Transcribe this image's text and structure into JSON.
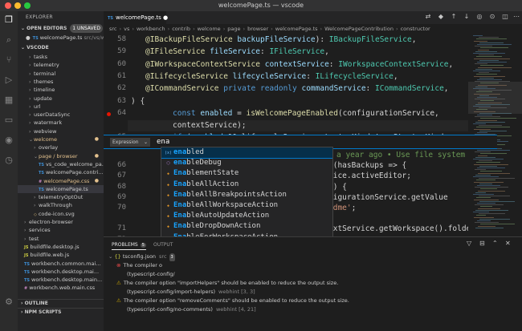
{
  "window": {
    "title": "welcomePage.ts — vscode"
  },
  "activity_bar": {
    "icons": [
      "files-icon",
      "search-icon",
      "source-control-icon",
      "run-debug-icon",
      "extensions-icon",
      "remote-explorer-icon",
      "github-icon",
      "timeline-icon",
      "settings-gear-icon"
    ]
  },
  "sidebar": {
    "header": "EXPLORER",
    "open_editors": {
      "label": "OPEN EDITORS",
      "badge": "1 UNSAVED"
    },
    "open_editor_item": {
      "name": "welcomePage.ts",
      "path": "src/vs/w..."
    },
    "vscode_section": "VSCODE",
    "tree": [
      {
        "label": "tasks",
        "type": "folder",
        "indent": 2
      },
      {
        "label": "telemetry",
        "type": "folder",
        "indent": 2
      },
      {
        "label": "terminal",
        "type": "folder",
        "indent": 2
      },
      {
        "label": "themes",
        "type": "folder",
        "indent": 2
      },
      {
        "label": "timeline",
        "type": "folder",
        "indent": 2
      },
      {
        "label": "update",
        "type": "folder",
        "indent": 2
      },
      {
        "label": "url",
        "type": "folder",
        "indent": 2
      },
      {
        "label": "userDataSync",
        "type": "folder",
        "indent": 2
      },
      {
        "label": "watermark",
        "type": "folder",
        "indent": 2
      },
      {
        "label": "webview",
        "type": "folder",
        "indent": 2
      },
      {
        "label": "welcome",
        "type": "folder-open",
        "indent": 2,
        "modified": true
      },
      {
        "label": "overlay",
        "type": "folder",
        "indent": 3
      },
      {
        "label": "page / browser",
        "type": "folder-open",
        "indent": 3,
        "modified": true
      },
      {
        "label": "vs_code_welcome_pa...",
        "type": "ts",
        "indent": 4
      },
      {
        "label": "welcomePage.contri...",
        "type": "ts",
        "indent": 4
      },
      {
        "label": "welcomePage.css",
        "type": "css",
        "indent": 4,
        "modified": true
      },
      {
        "label": "welcomePage.ts",
        "type": "ts",
        "indent": 4,
        "selected": true
      },
      {
        "label": "telemetryOptOut",
        "type": "folder",
        "indent": 3
      },
      {
        "label": "walkThrough",
        "type": "folder",
        "indent": 3
      },
      {
        "label": "code-icon.svg",
        "type": "svg",
        "indent": 3
      },
      {
        "label": "electron-browser",
        "type": "folder",
        "indent": 1
      },
      {
        "label": "services",
        "type": "folder",
        "indent": 1
      },
      {
        "label": "test",
        "type": "folder",
        "indent": 1
      },
      {
        "label": "buildfile.desktop.js",
        "type": "js",
        "indent": 1
      },
      {
        "label": "buildfile.web.js",
        "type": "js",
        "indent": 1
      },
      {
        "label": "workbench.common.mai...",
        "type": "ts",
        "indent": 1
      },
      {
        "label": "workbench.desktop.mai...",
        "type": "ts",
        "indent": 1
      },
      {
        "label": "workbench.desktop.main...",
        "type": "ts",
        "indent": 1
      },
      {
        "label": "workbench.web.main.css",
        "type": "css",
        "indent": 1
      }
    ],
    "outline": "OUTLINE",
    "npm_scripts": "NPM SCRIPTS"
  },
  "tabs": [
    {
      "label": "welcomePage.ts",
      "dirty": true
    }
  ],
  "breadcrumb": [
    "src",
    "vs",
    "workbench",
    "contrib",
    "welcome",
    "page",
    "browser",
    "welcomePage.ts",
    "WelcomePageContribution",
    "constructor"
  ],
  "editor": {
    "lines_top": [
      {
        "n": "58",
        "code": [
          [
            "dec",
            "@IBackupFileService "
          ],
          [
            "var",
            "backupFileService"
          ],
          [
            "",
            "): "
          ],
          [
            "ty",
            "IBackupFileService"
          ],
          [
            "",
            ","
          ]
        ]
      },
      {
        "n": "59",
        "code": [
          [
            "dec",
            "@IFileService "
          ],
          [
            "var",
            "fileService"
          ],
          [
            "",
            ": "
          ],
          [
            "ty",
            "IFileService"
          ],
          [
            "",
            ","
          ]
        ]
      },
      {
        "n": "60",
        "code": [
          [
            "dec",
            "@IWorkspaceContextService "
          ],
          [
            "var",
            "contextService"
          ],
          [
            "",
            ": "
          ],
          [
            "ty",
            "IWorkspaceContextService"
          ],
          [
            "",
            ","
          ]
        ]
      },
      {
        "n": "61",
        "code": [
          [
            "dec",
            "@ILifecycleService "
          ],
          [
            "var",
            "lifecycleService"
          ],
          [
            "",
            ": "
          ],
          [
            "ty",
            "ILifecycleService"
          ],
          [
            "",
            ","
          ]
        ]
      },
      {
        "n": "62",
        "code": [
          [
            "dec",
            "@ICommandService "
          ],
          [
            "kw",
            "private readonly "
          ],
          [
            "var",
            "commandService"
          ],
          [
            "",
            ": "
          ],
          [
            "ty",
            "ICommandService"
          ],
          [
            "",
            ","
          ]
        ]
      },
      {
        "n": "63",
        "code": [
          [
            "",
            ") {"
          ]
        ]
      },
      {
        "n": "64",
        "bp": true,
        "code": [
          [
            "kw",
            "const "
          ],
          [
            "var",
            "enabled"
          ],
          [
            "",
            " = "
          ],
          [
            "fn",
            "isWelcomePageEnabled"
          ],
          [
            "",
            "(configurationService,"
          ]
        ]
      },
      {
        "n": "",
        "code": [
          [
            "",
            "contextService);"
          ]
        ]
      },
      {
        "n": "65",
        "bp": true,
        "code": [
          [
            "kw",
            "if "
          ],
          [
            "",
            "("
          ],
          [
            "var",
            "enabled"
          ],
          [
            "",
            " && lifecycleService.startupKind !== StartupKind."
          ]
        ]
      }
    ],
    "lines_bottom": [
      {
        "n": "",
        "code": [
          [
            "cm",
            "a year ago • Use file system servic"
          ]
        ]
      },
      {
        "n": "66",
        "code": [
          [
            "",
            "n(hasBackups => {"
          ]
        ]
      },
      {
        "n": "67",
        "code": [
          [
            "",
            "vice.activeEditor;"
          ]
        ]
      },
      {
        "n": "68",
        "code": [
          [
            "",
            "s) {"
          ]
        ]
      },
      {
        "n": "69",
        "code": [
          [
            "",
            "figurationService.getValue"
          ]
        ]
      },
      {
        "n": "70",
        "code": [
          [
            "str",
            "adme'"
          ],
          [
            "",
            ";"
          ]
        ]
      },
      {
        "n": "",
        "code": [
          [
            "",
            ""
          ]
        ]
      },
      {
        "n": "71",
        "code": [
          [
            "",
            "extService.getWorkspace().folders."
          ]
        ]
      },
      {
        "n": "72",
        "code": [
          [
            "",
            ""
          ]
        ]
      }
    ]
  },
  "debug_input": {
    "mode": "Expression",
    "value": "ena"
  },
  "suggestions": [
    {
      "match": "ena",
      "rest": "bled",
      "kind": "var"
    },
    {
      "match": "ena",
      "rest": "bleDebug",
      "kind": "fn"
    },
    {
      "match": "Ena",
      "rest": "blementState",
      "kind": "cls"
    },
    {
      "match": "Ena",
      "rest": "bleAllAction",
      "kind": "cls"
    },
    {
      "match": "Ena",
      "rest": "bleAllBreakpointsAction",
      "kind": "cls"
    },
    {
      "match": "Ena",
      "rest": "bleAllWorkspaceAction",
      "kind": "cls"
    },
    {
      "match": "Ena",
      "rest": "bleAutoUpdateAction",
      "kind": "cls"
    },
    {
      "match": "Ena",
      "rest": "bleDropDownAction",
      "kind": "cls"
    },
    {
      "match": "Ena",
      "rest": "bleForWorkspaceAction",
      "kind": "cls"
    },
    {
      "match": "Ena",
      "rest": "bleGloballyAction",
      "kind": "cls"
    },
    {
      "match": "Ena",
      "rest": "bleSearchEditorPreview",
      "kind": "cls"
    },
    {
      "match": "ena",
      "rest": "bledExtensionsView",
      "kind": "cls"
    }
  ],
  "panel": {
    "tabs": [
      {
        "label": "PROBLEMS",
        "badge": "5",
        "active": true
      },
      {
        "label": "OUTPUT",
        "active": false
      }
    ],
    "rows": [
      {
        "icon": "chevron",
        "text": "tsconfig.json",
        "dim": "src",
        "badge": "3"
      },
      {
        "icon": "error",
        "text": "The compiler o",
        "dim": ""
      },
      {
        "icon": "",
        "text": "(typescript-config/",
        "dim": ""
      },
      {
        "icon": "warn",
        "text": "The compiler option \"importHelpers\" should be enabled to reduce the output size.",
        "dim": ""
      },
      {
        "icon": "",
        "text": "(typescript-config/import-helpers)",
        "dim": "webhint  [3, 3]"
      },
      {
        "icon": "warn",
        "text": "The compiler option \"removeComments\" should be enabled to reduce the output size.",
        "dim": ""
      },
      {
        "icon": "",
        "text": "(typescript-config/no-comments)",
        "dim": "webhint  [4, 21]"
      }
    ]
  },
  "colors": {
    "accent": "#007acc",
    "breakpoint": "#e51400",
    "warning": "#cca700",
    "error": "#f14c4c"
  }
}
